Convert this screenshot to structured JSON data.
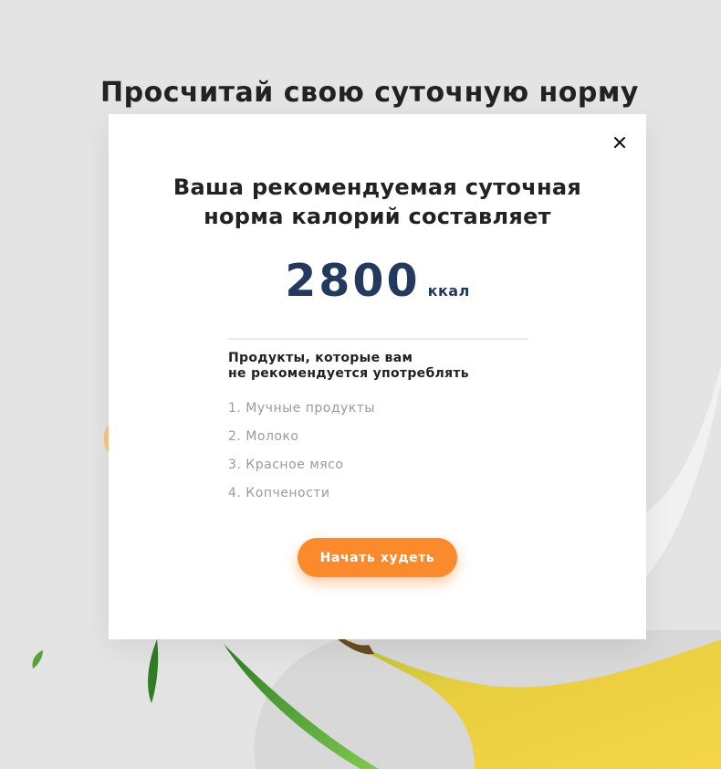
{
  "page": {
    "title": "Просчитай свою суточную норму"
  },
  "modal": {
    "heading_line1": "Ваша рекомендуемая суточная",
    "heading_line2": "норма калорий составляет",
    "calories_value": "2800",
    "calories_unit": "ккал",
    "products_title_line1": "Продукты, которые вам",
    "products_title_line2": "не рекомендуется употреблять",
    "products": [
      "1. Мучные продукты",
      "2. Молоко",
      "3. Красное мясо",
      "4. Копчености"
    ],
    "cta_label": "Начать худеть",
    "close_icon": "close-icon"
  },
  "colors": {
    "accent": "#fb8a2c",
    "number": "#233a5e",
    "background": "#e4e4e4"
  }
}
